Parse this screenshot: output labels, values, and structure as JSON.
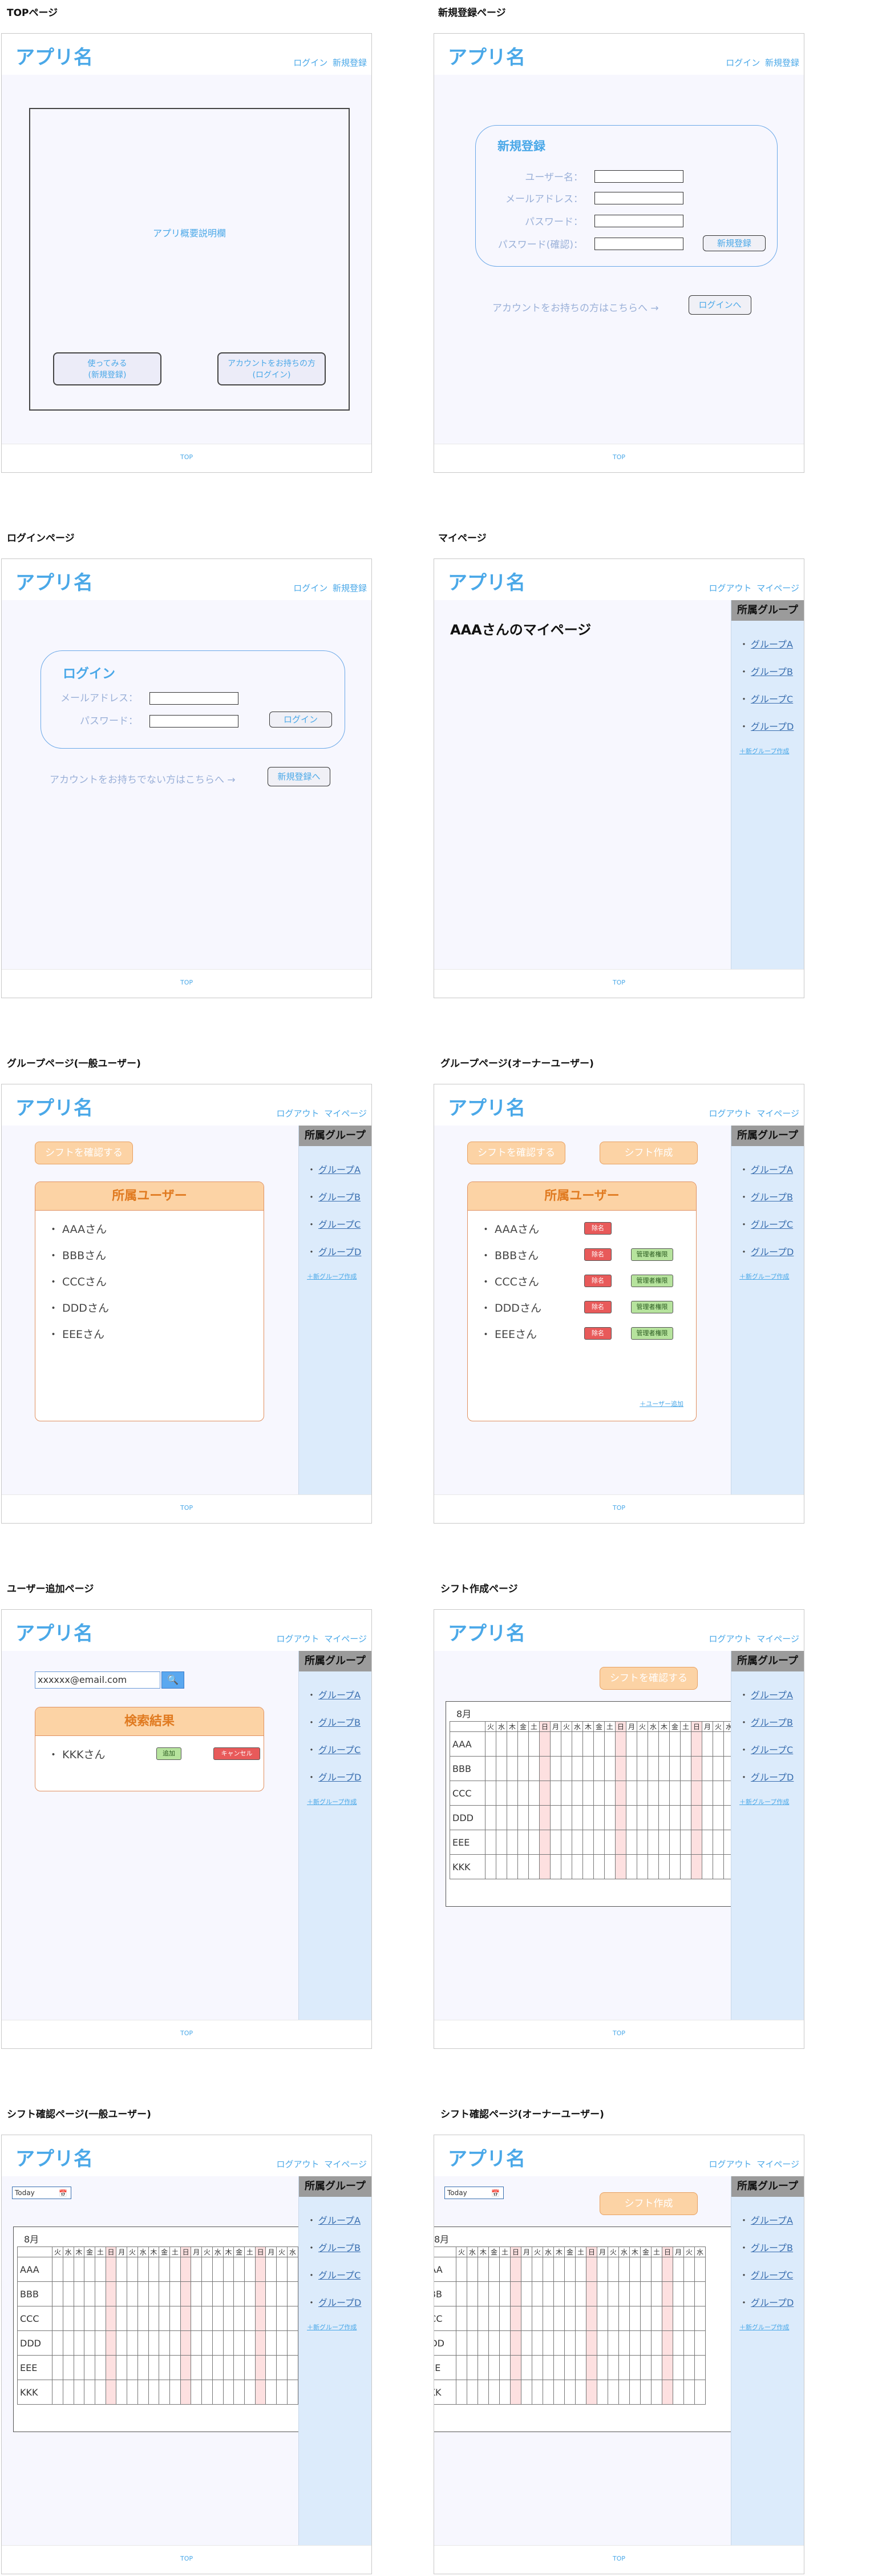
{
  "common": {
    "logo": "アプリ名",
    "footer": "TOP",
    "nav_guest": "ログイン 新規登録",
    "nav_user": "ログアウト マイページ",
    "sidebar_title": "所属グループ",
    "groups": [
      "グループA",
      "グループB",
      "グループC",
      "グループD"
    ],
    "create_group": "＋新グループ作成",
    "check_shift": "シフトを確認する",
    "create_shift": "シフト作成",
    "month": "8月",
    "weekdays": [
      "火",
      "水",
      "木",
      "金",
      "土",
      "日",
      "月",
      "火",
      "水",
      "木",
      "金",
      "土",
      "日",
      "月",
      "火",
      "水",
      "木",
      "金",
      "土",
      "日",
      "月",
      "火",
      "水"
    ],
    "holiday_flags": [
      0,
      0,
      0,
      0,
      0,
      1,
      0,
      0,
      0,
      0,
      0,
      0,
      1,
      0,
      0,
      0,
      0,
      0,
      0,
      1,
      0,
      0,
      0
    ],
    "shift_rows": [
      "AAA",
      "BBB",
      "CCC",
      "DDD",
      "EEE",
      "KKK"
    ],
    "member_list": [
      "AAAさん",
      "BBBさん",
      "CCCさん",
      "DDDさん",
      "EEEさん"
    ],
    "members_title": "所属ユーザー",
    "today": "Today"
  },
  "pages": {
    "top": {
      "title": "TOPページ",
      "overview": "アプリ概要説明欄",
      "try_button": "使ってみる\n(新規登録)",
      "have_account_button": "アカウントをお持ちの方\n(ログイン)"
    },
    "register": {
      "title": "新規登録ページ",
      "heading": "新規登録",
      "username": "ユーザー名：",
      "email": "メールアドレス：",
      "password": "パスワード：",
      "password_confirm": "パスワード(確認)：",
      "submit": "新規登録",
      "have_account": "アカウントをお持ちの方はこちらへ →",
      "to_login": "ログインへ"
    },
    "login": {
      "title": "ログインページ",
      "heading": "ログイン",
      "email": "メールアドレス：",
      "password": "パスワード：",
      "submit": "ログイン",
      "no_account": "アカウントをお持ちでない方はこちらへ →",
      "to_register": "新規登録へ"
    },
    "mypage": {
      "title": "マイページ",
      "heading": "AAAさんのマイページ"
    },
    "group_general": {
      "title": "グループページ(一般ユーザー)"
    },
    "group_owner": {
      "title": "グループページ(オーナーユーザー)",
      "remove": "除名",
      "make_admin": "管理者権限",
      "add_user": "＋ユーザー追加"
    },
    "add_user": {
      "title": "ユーザー追加ページ",
      "search_value": "xxxxxx@email.com",
      "result_title": "検索結果",
      "result_name": "KKKさん",
      "add": "追加",
      "cancel": "キャンセル"
    },
    "shift_create": {
      "title": "シフト作成ページ"
    },
    "shift_general": {
      "title": "シフト確認ページ(一般ユーザー)"
    },
    "shift_owner": {
      "title": "シフト確認ページ(オーナーユーザー)"
    }
  }
}
